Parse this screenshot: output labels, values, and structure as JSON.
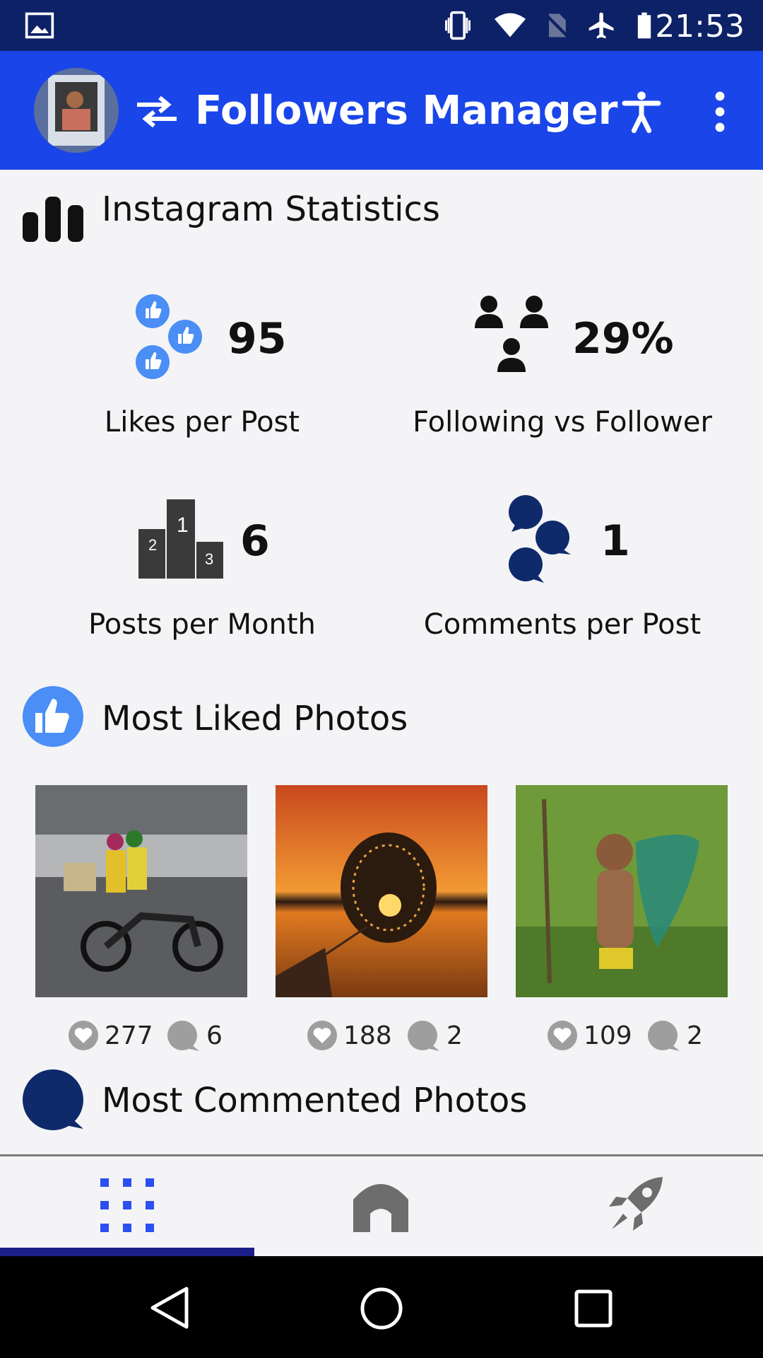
{
  "status_bar": {
    "time": "21:53"
  },
  "app_bar": {
    "title": "Followers Manager"
  },
  "stats_section": {
    "title": "Instagram Statistics",
    "items": [
      {
        "value": "95",
        "label": "Likes per Post"
      },
      {
        "value": "29%",
        "label": "Following vs Follower"
      },
      {
        "value": "6",
        "label": "Posts per Month"
      },
      {
        "value": "1",
        "label": "Comments per Post"
      }
    ]
  },
  "most_liked": {
    "title": "Most Liked Photos",
    "photos": [
      {
        "likes": "277",
        "comments": "6"
      },
      {
        "likes": "188",
        "comments": "2"
      },
      {
        "likes": "109",
        "comments": "2"
      }
    ]
  },
  "most_commented": {
    "title": "Most Commented Photos"
  },
  "colors": {
    "app_bar": "#1a45e8",
    "status_bar": "#0d2167",
    "accent_blue": "#4a8ef6",
    "navy": "#0f2a6b",
    "tab_indicator": "#1c1e8a"
  },
  "icons": {
    "status": [
      "gallery-icon",
      "vibrate-icon",
      "wifi-icon",
      "no-sim-icon",
      "airplane-icon",
      "battery-icon"
    ],
    "app_bar": [
      "swap-icon",
      "accessibility-icon",
      "more-vert-icon"
    ],
    "bottom_nav": [
      "grid-icon",
      "home-icon",
      "rocket-icon"
    ]
  }
}
